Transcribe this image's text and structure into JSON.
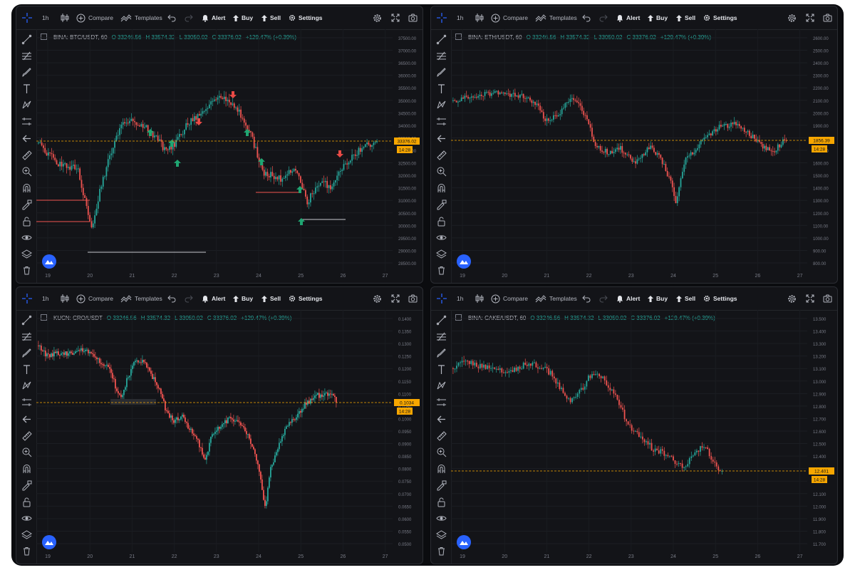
{
  "toolbar": {
    "interval": "1h",
    "compare": "Compare",
    "templates": "Templates",
    "alert": "Alert",
    "buy": "Buy",
    "sell": "Sell",
    "settings": "Settings"
  },
  "colors": {
    "up": "#26a69a",
    "down": "#ef5350",
    "price_line": "#f7a600",
    "bg": "#131418"
  },
  "panels": [
    {
      "symbol": "BINA: BTC/USDT, 60",
      "o": "O 33246.56",
      "h": "H 33574.32",
      "l": "L 33050.02",
      "c": "C 33376.02",
      "change": "+129.47% (+0.39%)",
      "price_label": "33376.02",
      "time_label": "14:28",
      "y_ticks": [
        "37500.00",
        "37000.00",
        "36500.00",
        "36000.00",
        "35500.00",
        "35000.00",
        "34500.00",
        "34000.00",
        "33500.00",
        "33000.00",
        "32500.00",
        "32000.00",
        "31500.00",
        "31000.00",
        "30500.00",
        "30000.00",
        "29500.00",
        "29000.00",
        "28500.00"
      ],
      "x_ticks": [
        "19",
        "20",
        "21",
        "22",
        "23",
        "24",
        "25",
        "26",
        "27"
      ]
    },
    {
      "symbol": "BINA: ETH/USDT, 60",
      "o": "O 33246.56",
      "h": "H 33574.32",
      "l": "L 33050.02",
      "c": "C 33376.02",
      "change": "+129.47% (+0.39%)",
      "price_label": "1856.39",
      "time_label": "14:28",
      "y_ticks": [
        "2600.00",
        "2500.00",
        "2400.00",
        "2300.00",
        "2200.00",
        "2100.00",
        "2000.00",
        "1900.00",
        "1800.00",
        "1700.00",
        "1600.00",
        "1500.00",
        "1400.00",
        "1300.00",
        "1200.00",
        "1100.00",
        "1000.00",
        "900.00",
        "800.00"
      ],
      "x_ticks": [
        "19",
        "20",
        "21",
        "22",
        "23",
        "24",
        "25",
        "26",
        "27"
      ]
    },
    {
      "symbol": "KUCN: CRO/USDT",
      "o": "O 33246.56",
      "h": "H 33574.32",
      "l": "L 33050.02",
      "c": "C 33376.02",
      "change": "+129.47% (+0.39%)",
      "price_label": "0.1034",
      "time_label": "14:28",
      "y_ticks": [
        "0.1400",
        "0.1350",
        "0.1300",
        "0.1250",
        "0.1200",
        "0.1150",
        "0.1100",
        "0.1050",
        "0.1000",
        "0.0950",
        "0.0900",
        "0.0850",
        "0.0800",
        "0.0750",
        "0.0700",
        "0.0650",
        "0.0600",
        "0.0550",
        "0.0500"
      ],
      "x_ticks": [
        "19",
        "20",
        "21",
        "22",
        "23",
        "24",
        "25",
        "26",
        "27"
      ]
    },
    {
      "symbol": "BINA: CAKE/USDT, 60",
      "o": "O 33246.56",
      "h": "H 33574.32",
      "l": "L 33050.02",
      "c": "C 33376.02",
      "change": "+129.47% (+0.39%)",
      "price_label": "12.401",
      "time_label": "14:28",
      "y_ticks": [
        "13.500",
        "13.400",
        "13.300",
        "13.200",
        "13.100",
        "13.000",
        "12.900",
        "12.800",
        "12.700",
        "12.600",
        "12.500",
        "12.400",
        "12.300",
        "12.200",
        "12.100",
        "12.000",
        "11.900",
        "11.800",
        "11.700"
      ],
      "x_ticks": [
        "19",
        "20",
        "21",
        "22",
        "23",
        "24",
        "25",
        "26",
        "27"
      ]
    }
  ],
  "icons": {
    "top": [
      "crosshair-icon",
      "candles-icon",
      "compare-icon",
      "templates-icon",
      "undo-icon",
      "redo-icon",
      "alert-icon",
      "buy-icon",
      "sell-icon",
      "settings-icon",
      "gear-icon",
      "fullscreen-icon",
      "camera-icon"
    ],
    "left": [
      "trend-line-icon",
      "fib-icon",
      "brush-icon",
      "text-icon",
      "pattern-icon",
      "measure-icon",
      "arrow-left-icon",
      "ruler-icon",
      "zoom-icon",
      "magnet-icon",
      "lock-pen-icon",
      "lock-icon",
      "eye-icon",
      "layers-icon",
      "trash-icon"
    ]
  }
}
